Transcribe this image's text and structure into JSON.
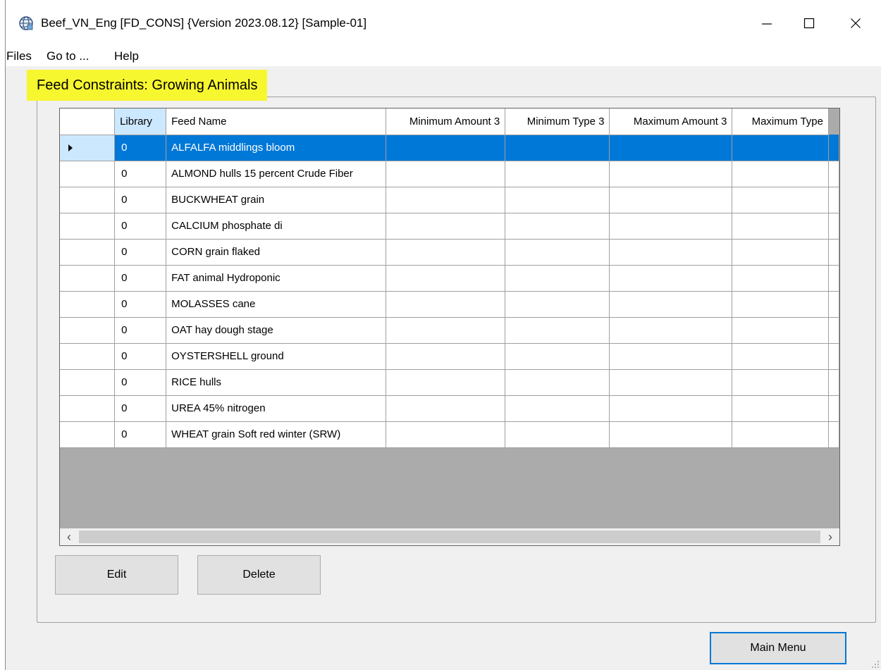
{
  "window": {
    "title": "Beef_VN_Eng [FD_CONS] {Version 2023.08.12}  [Sample-01]",
    "minimize": "—",
    "maximize": "☐",
    "close": "✕"
  },
  "menu": {
    "items": [
      "Files",
      "Go to ...",
      "Help"
    ]
  },
  "page": {
    "title": "Feed Constraints: Growing Animals"
  },
  "grid": {
    "columns": [
      "Library",
      "Feed Name",
      "Minimum Amount 3",
      "Minimum Type 3",
      "Maximum Amount 3",
      "Maximum Type"
    ],
    "selected_row": 0,
    "rows": [
      {
        "library": "0",
        "feed_name": "ALFALFA middlings bloom",
        "min_amount": "",
        "min_type": "",
        "max_amount": "",
        "max_type": ""
      },
      {
        "library": "0",
        "feed_name": "ALMOND hulls 15 percent Crude Fiber",
        "min_amount": "",
        "min_type": "",
        "max_amount": "",
        "max_type": ""
      },
      {
        "library": "0",
        "feed_name": "BUCKWHEAT grain",
        "min_amount": "",
        "min_type": "",
        "max_amount": "",
        "max_type": ""
      },
      {
        "library": "0",
        "feed_name": "CALCIUM phosphate di",
        "min_amount": "",
        "min_type": "",
        "max_amount": "",
        "max_type": ""
      },
      {
        "library": "0",
        "feed_name": "CORN grain flaked",
        "min_amount": "",
        "min_type": "",
        "max_amount": "",
        "max_type": ""
      },
      {
        "library": "0",
        "feed_name": "FAT animal Hydroponic",
        "min_amount": "",
        "min_type": "",
        "max_amount": "",
        "max_type": ""
      },
      {
        "library": "0",
        "feed_name": "MOLASSES cane",
        "min_amount": "",
        "min_type": "",
        "max_amount": "",
        "max_type": ""
      },
      {
        "library": "0",
        "feed_name": "OAT hay dough stage",
        "min_amount": "",
        "min_type": "",
        "max_amount": "",
        "max_type": ""
      },
      {
        "library": "0",
        "feed_name": "OYSTERSHELL ground",
        "min_amount": "",
        "min_type": "",
        "max_amount": "",
        "max_type": ""
      },
      {
        "library": "0",
        "feed_name": "RICE hulls",
        "min_amount": "",
        "min_type": "",
        "max_amount": "",
        "max_type": ""
      },
      {
        "library": "0",
        "feed_name": "UREA 45% nitrogen",
        "min_amount": "",
        "min_type": "",
        "max_amount": "",
        "max_type": ""
      },
      {
        "library": "0",
        "feed_name": "WHEAT grain Soft red winter (SRW)",
        "min_amount": "",
        "min_type": "",
        "max_amount": "",
        "max_type": ""
      }
    ]
  },
  "scrollbar": {
    "left_arrow": "‹",
    "right_arrow": "›"
  },
  "buttons": {
    "edit": "Edit",
    "delete": "Delete",
    "main_menu": "Main Menu"
  },
  "colors": {
    "selection": "#0078d7",
    "title_highlight": "#f7f730",
    "row_header_selected": "#cce8ff"
  }
}
